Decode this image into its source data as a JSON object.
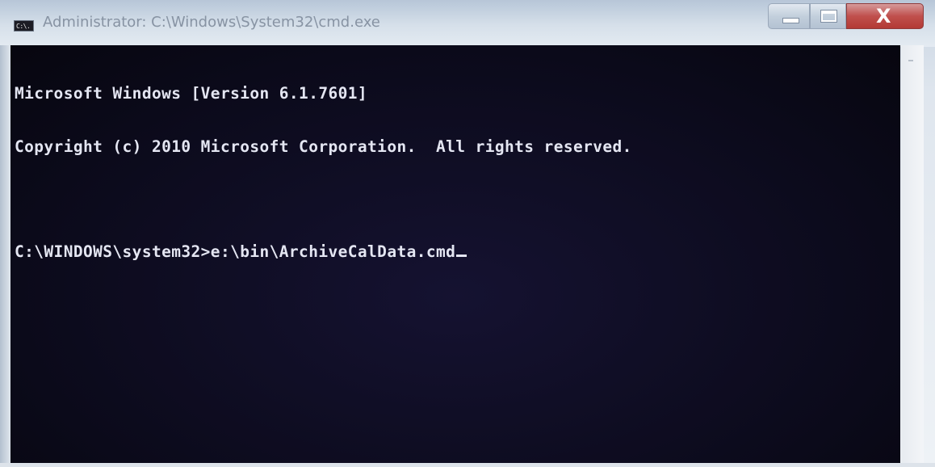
{
  "window": {
    "title": "Administrator: C:\\Windows\\System32\\cmd.exe",
    "icon_label": "C:\\."
  },
  "caption_buttons": {
    "minimize": "minimize-icon",
    "maximize": "maximize-icon",
    "close_glyph": "X"
  },
  "console": {
    "lines": [
      "Microsoft Windows [Version 6.1.7601]",
      "Copyright (c) 2010 Microsoft Corporation.  All rights reserved.",
      "",
      "C:\\WINDOWS\\system32>e:\\bin\\ArchiveCalData.cmd"
    ],
    "text_color": "#e4e6f2",
    "background_color": "#0d0b1c"
  }
}
